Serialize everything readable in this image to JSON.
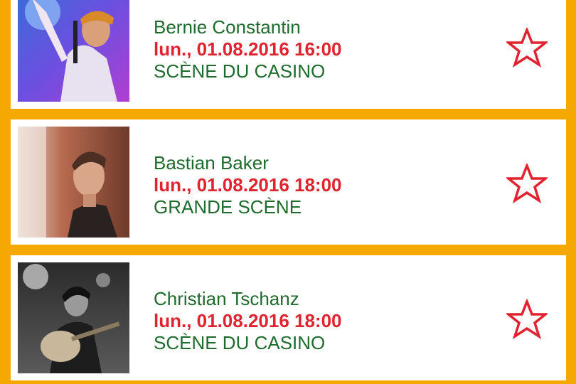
{
  "events": [
    {
      "artist": "Bernie Constantin",
      "datetime": "lun., 01.08.2016 16:00",
      "stage": "SCÈNE DU CASINO",
      "photo": "artist-photo-bernie-constantin",
      "favorite_icon": "star-outline-icon"
    },
    {
      "artist": "Bastian Baker",
      "datetime": "lun., 01.08.2016 18:00",
      "stage": "GRANDE SCÈNE",
      "photo": "artist-photo-bastian-baker",
      "favorite_icon": "star-outline-icon"
    },
    {
      "artist": "Christian Tschanz",
      "datetime": "lun., 01.08.2016 18:00",
      "stage": "SCÈNE DU CASINO",
      "photo": "artist-photo-christian-tschanz",
      "favorite_icon": "star-outline-icon"
    }
  ],
  "colors": {
    "background": "#f5a800",
    "artist_text": "#1f6b2e",
    "datetime_text": "#e0232f",
    "star_outline": "#e0232f"
  }
}
